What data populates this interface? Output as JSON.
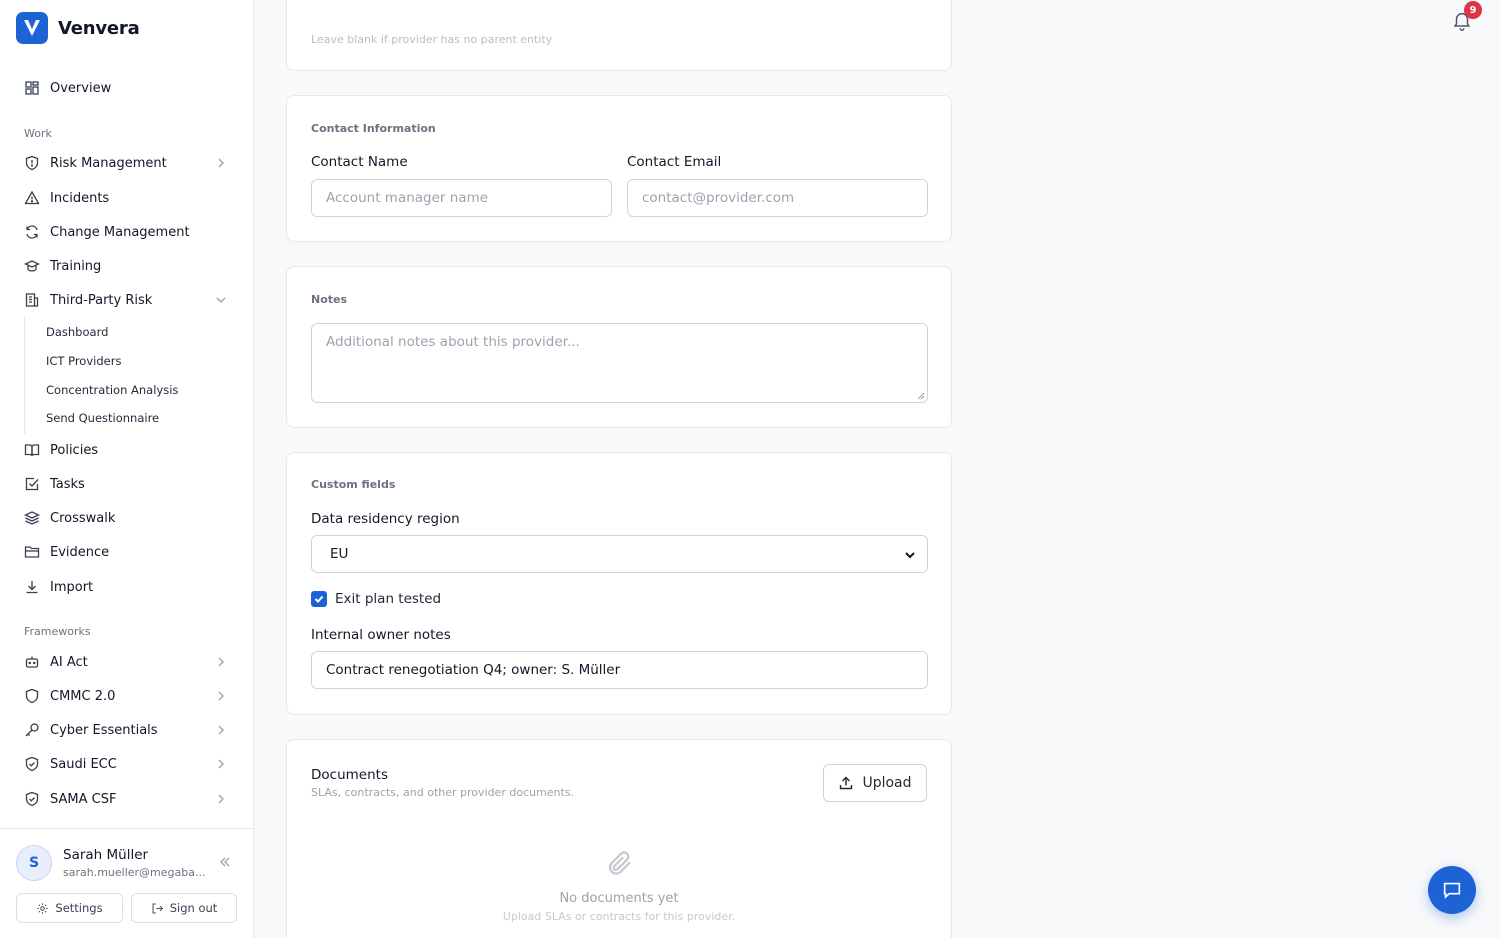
{
  "app": {
    "name": "Venvera"
  },
  "sidebar": {
    "overview": "Overview",
    "work_label": "Work",
    "work_items": [
      {
        "label": "Risk Management",
        "icon": "shield-icon"
      },
      {
        "label": "Incidents",
        "icon": "warning-triangle-icon"
      },
      {
        "label": "Change Management",
        "icon": "refresh-icon"
      },
      {
        "label": "Training",
        "icon": "graduation-cap-icon"
      },
      {
        "label": "Third-Party Risk",
        "icon": "building-icon"
      }
    ],
    "third_party_sub": [
      "Dashboard",
      "ICT Providers",
      "Concentration Analysis",
      "Send Questionnaire"
    ],
    "work_items_2": [
      {
        "label": "Policies",
        "icon": "book-icon"
      },
      {
        "label": "Tasks",
        "icon": "checkbox-icon"
      },
      {
        "label": "Crosswalk",
        "icon": "layers-icon"
      },
      {
        "label": "Evidence",
        "icon": "folder-icon"
      },
      {
        "label": "Import",
        "icon": "download-icon"
      }
    ],
    "frameworks_label": "Frameworks",
    "frameworks": [
      {
        "label": "AI Act",
        "icon": "bot-icon"
      },
      {
        "label": "CMMC 2.0",
        "icon": "shield-icon"
      },
      {
        "label": "Cyber Essentials",
        "icon": "key-icon"
      },
      {
        "label": "Saudi ECC",
        "icon": "shield-check-icon"
      },
      {
        "label": "SAMA CSF",
        "icon": "shield-check-icon"
      }
    ]
  },
  "user": {
    "initial": "S",
    "name": "Sarah Müller",
    "email": "sarah.mueller@megaba...",
    "settings_label": "Settings",
    "signout_label": "Sign out"
  },
  "notifications": {
    "count": "9"
  },
  "top_card": {
    "hint": "Leave blank if provider has no parent entity"
  },
  "contact": {
    "section": "Contact Information",
    "name_label": "Contact Name",
    "name_placeholder": "Account manager name",
    "email_label": "Contact Email",
    "email_placeholder": "contact@provider.com"
  },
  "notes": {
    "section": "Notes",
    "placeholder": "Additional notes about this provider..."
  },
  "custom_fields": {
    "section": "Custom fields",
    "region_label": "Data residency region",
    "region_value": "EU",
    "exit_plan_label": "Exit plan tested",
    "exit_plan_checked": true,
    "owner_notes_label": "Internal owner notes",
    "owner_notes_value": "Contract renegotiation Q4; owner: S. Müller"
  },
  "documents": {
    "title": "Documents",
    "subtitle": "SLAs, contracts, and other provider documents.",
    "upload_label": "Upload",
    "empty_title": "No documents yet",
    "empty_subtitle": "Upload SLAs or contracts for this provider."
  },
  "colors": {
    "accent": "#1e63d6",
    "badge": "#dc3545"
  }
}
